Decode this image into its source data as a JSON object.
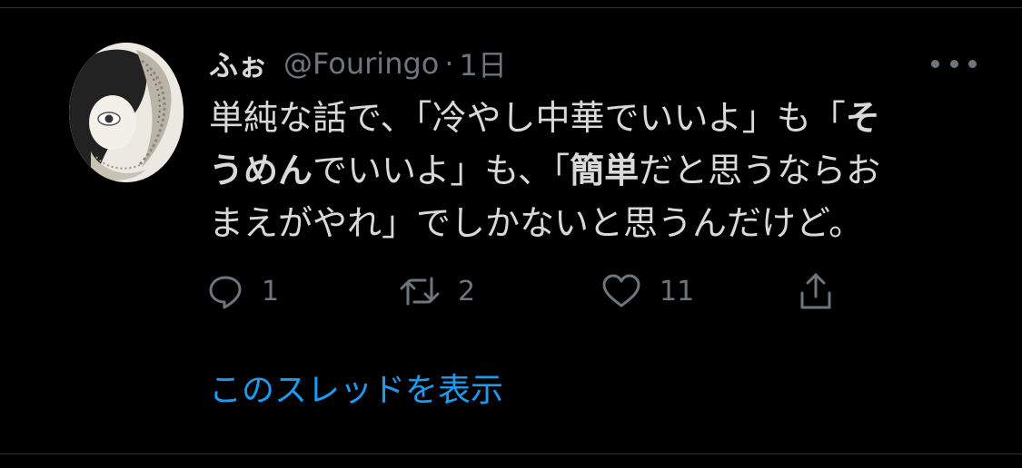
{
  "tweet": {
    "display_name": "ふぉ",
    "handle": "@Fouringo",
    "separator": "·",
    "time": "1日",
    "text_line1_a": "単純な話で、「冷やし中華でいいよ」も「",
    "text_line1_b": "そ",
    "text_line2_a": "うめん",
    "text_line2_b": "でいいよ」も、「",
    "text_line2_c": "簡単",
    "text_line2_d": "だと思うならお",
    "text_line3": "まえがやれ」でしかないと思うんだけど。",
    "reply_count": "1",
    "retweet_count": "2",
    "like_count": "11"
  },
  "thread_link": "このスレッドを表示",
  "icons": {
    "more": "more-horizontal-icon",
    "reply": "reply-icon",
    "retweet": "retweet-icon",
    "like": "heart-icon",
    "share": "share-icon"
  },
  "colors": {
    "background": "#000000",
    "text": "#d9d9d9",
    "secondary": "#6e767d",
    "link": "#1d9bf0"
  }
}
